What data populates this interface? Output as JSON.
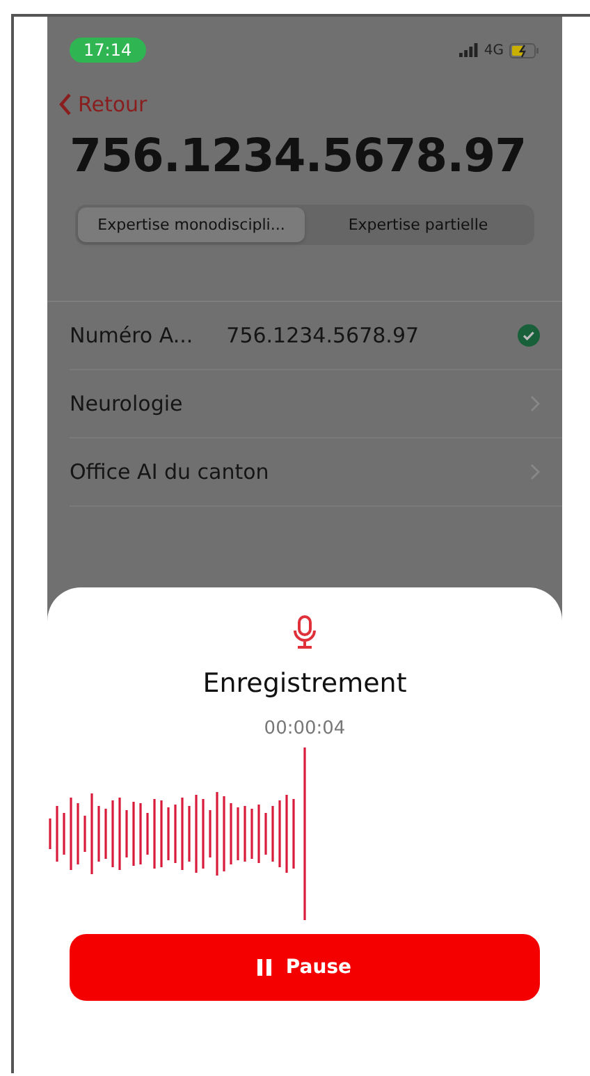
{
  "status_bar": {
    "time": "17:14",
    "network": "4G"
  },
  "back": {
    "label": "Retour"
  },
  "title": "756.1234.5678.97",
  "segments": [
    {
      "label": "Expertise monodiscipli...",
      "selected": true
    },
    {
      "label": "Expertise partielle",
      "selected": false
    }
  ],
  "rows": [
    {
      "kind": "verified",
      "label": "Numéro A...",
      "value": "756.1234.5678.97"
    },
    {
      "kind": "link",
      "label": "Neurologie"
    },
    {
      "kind": "link",
      "label": "Office AI du canton"
    }
  ],
  "sheet": {
    "title": "Enregistrement",
    "timer": "00:00:04",
    "button": {
      "label": "Pause"
    }
  }
}
